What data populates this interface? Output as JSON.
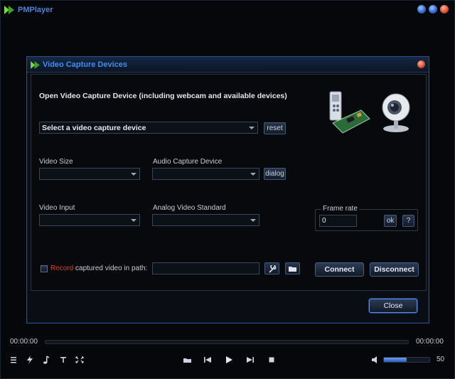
{
  "app": {
    "title": "PMPlayer"
  },
  "dialog": {
    "title": "Video Capture Devices",
    "heading": "Open Video Capture Device  (including webcam and available devices)",
    "device_select": {
      "value": "Select a video capture device"
    },
    "reset_label": "reset",
    "video_size": {
      "label": "Video Size",
      "value": ""
    },
    "audio_device": {
      "label": "Audio Capture Device",
      "value": ""
    },
    "dialog_label": "dialog",
    "video_input": {
      "label": "Video Input",
      "value": ""
    },
    "analog_standard": {
      "label": "Analog Video Standard",
      "value": ""
    },
    "frame_rate": {
      "label": "Frame rate",
      "value": "0",
      "ok_label": "ok",
      "help_label": "?"
    },
    "record": {
      "checked": false,
      "word": "Record",
      "rest": "captured video in path:",
      "path": ""
    },
    "connect_label": "Connect",
    "disconnect_label": "Disconnect",
    "close_label": "Close"
  },
  "player": {
    "time_current": "00:00:00",
    "time_total": "00:00:00",
    "volume": 50,
    "volume_text": "50"
  },
  "colors": {
    "accent": "#3f8cf0",
    "record_red": "#e0392b",
    "background": "#05070a"
  },
  "icons": [
    "menu-icon",
    "lightning-icon",
    "music-note-icon",
    "text-icon",
    "fullscreen-icon",
    "open-folder-icon",
    "previous-icon",
    "play-icon",
    "next-icon",
    "stop-icon",
    "volume-icon",
    "wrench-icon",
    "folder-icon",
    "webcam-icon",
    "capture-card-icon"
  ]
}
